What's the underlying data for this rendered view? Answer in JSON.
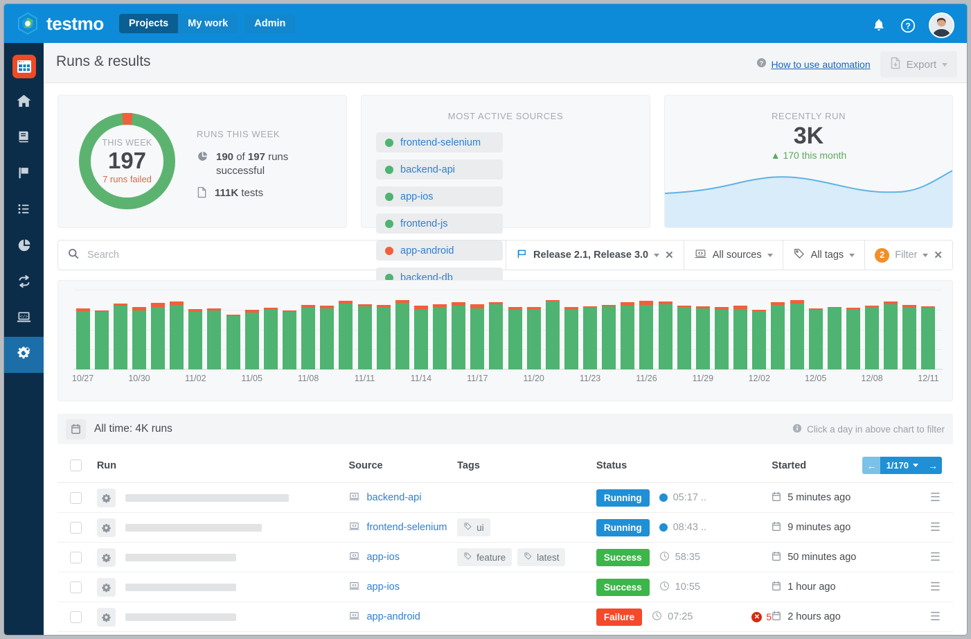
{
  "brand": {
    "name": "testmo",
    "color": "#0d8bd9"
  },
  "topnav": {
    "items": [
      {
        "label": "Projects",
        "active": true
      },
      {
        "label": "My work",
        "active": false
      },
      {
        "label": "Admin",
        "active": false,
        "separate": true
      }
    ],
    "icons": [
      {
        "name": "notifications-icon"
      },
      {
        "name": "help-icon"
      },
      {
        "name": "user-avatar"
      }
    ]
  },
  "sidebar": {
    "items": [
      {
        "name": "project-logo",
        "label": "Project"
      },
      {
        "name": "home-icon",
        "label": "Home"
      },
      {
        "name": "book-icon",
        "label": "Cases"
      },
      {
        "name": "flag-icon",
        "label": "Milestones"
      },
      {
        "name": "list-icon",
        "label": "Runs"
      },
      {
        "name": "pie-chart-icon",
        "label": "Reports"
      },
      {
        "name": "repeat-icon",
        "label": "Sessions"
      },
      {
        "name": "code-laptop-icon",
        "label": "Automation"
      },
      {
        "name": "gears-icon",
        "label": "Settings",
        "active": true
      }
    ]
  },
  "header": {
    "title": "Runs & results",
    "howto_label": "How to use automation",
    "export_label": "Export"
  },
  "cards": {
    "week": {
      "donut_label": "THIS WEEK",
      "donut_value": "197",
      "donut_sub": "7 runs failed",
      "section_title": "RUNS THIS WEEK",
      "rows": [
        {
          "icon": "pie-chart-icon",
          "bold1": "190",
          "mid": " of ",
          "bold2": "197",
          "tail": " runs successful"
        },
        {
          "icon": "document-icon",
          "bold1": "111K",
          "mid": "",
          "bold2": "",
          "tail": " tests"
        }
      ],
      "success_pct": 96.4,
      "colors": {
        "pass": "#5cb370",
        "fail": "#f0603c"
      }
    },
    "sources": {
      "title": "MOST ACTIVE SOURCES",
      "items": [
        {
          "label": "frontend-selenium",
          "status": "pass"
        },
        {
          "label": "backend-api",
          "status": "pass"
        },
        {
          "label": "app-ios",
          "status": "pass"
        },
        {
          "label": "frontend-js",
          "status": "pass"
        },
        {
          "label": "app-android",
          "status": "fail"
        },
        {
          "label": "backend-db",
          "status": "pass"
        }
      ]
    },
    "recent": {
      "title": "RECENTLY RUN",
      "value": "3K",
      "trend": "170 this month",
      "trend_dir": "up"
    }
  },
  "filterbar": {
    "search_placeholder": "Search",
    "search_value": "",
    "milestone_label": "Release 2.1, Release 3.0",
    "sources_label": "All sources",
    "tags_label": "All tags",
    "filter_label": "Filter",
    "filter_count": "2"
  },
  "chart_data": {
    "type": "bar",
    "title": "",
    "xlabel": "",
    "ylabel": "",
    "stacked": true,
    "grid": true,
    "legend": "none",
    "ylim": [
      0,
      110
    ],
    "series": [
      {
        "name": "passed",
        "color": "#4fb371"
      },
      {
        "name": "failed",
        "color": "#f0603c"
      }
    ],
    "categories": [
      "10/27",
      "10/28",
      "10/29",
      "10/30",
      "10/31",
      "11/01",
      "11/02",
      "11/03",
      "11/04",
      "11/05",
      "11/06",
      "11/07",
      "11/08",
      "11/09",
      "11/10",
      "11/11",
      "11/12",
      "11/13",
      "11/14",
      "11/15",
      "11/16",
      "11/17",
      "11/18",
      "11/19",
      "11/20",
      "11/21",
      "11/22",
      "11/23",
      "11/24",
      "11/25",
      "11/26",
      "11/27",
      "11/28",
      "11/29",
      "11/30",
      "12/01",
      "12/02",
      "12/03",
      "12/04",
      "12/05",
      "12/06",
      "12/07",
      "12/08",
      "12/09",
      "12/10",
      "12/11"
    ],
    "tick_labels": [
      "10/27",
      "10/30",
      "11/02",
      "11/05",
      "11/08",
      "11/11",
      "11/14",
      "11/17",
      "11/20",
      "11/23",
      "11/26",
      "11/29",
      "12/02",
      "12/05",
      "12/08",
      "12/11"
    ],
    "tick_every": 3,
    "passed": [
      80,
      79,
      88,
      81,
      86,
      89,
      79,
      81,
      74,
      78,
      82,
      79,
      85,
      84,
      91,
      87,
      86,
      92,
      83,
      86,
      88,
      84,
      90,
      82,
      83,
      94,
      83,
      85,
      87,
      88,
      89,
      90,
      86,
      84,
      82,
      83,
      80,
      89,
      91,
      82,
      85,
      83,
      86,
      90,
      86,
      85
    ],
    "failed": [
      4,
      2,
      3,
      5,
      6,
      5,
      4,
      3,
      2,
      4,
      3,
      2,
      4,
      4,
      4,
      3,
      3,
      4,
      5,
      4,
      5,
      6,
      3,
      4,
      3,
      2,
      3,
      2,
      2,
      5,
      6,
      4,
      2,
      3,
      4,
      5,
      2,
      4,
      5,
      2,
      1,
      2,
      2,
      4,
      3,
      2
    ]
  },
  "alltime": {
    "label": "All time: 4K runs",
    "hint": "Click a day in above chart to filter"
  },
  "table": {
    "columns": [
      "Run",
      "Source",
      "Tags",
      "Status",
      "Started"
    ],
    "pager": {
      "page": "1/170"
    },
    "rows": [
      {
        "name_width": 236,
        "source": "backend-api",
        "tags": [],
        "status": {
          "label": "Running",
          "kind": "running"
        },
        "duration": "05:17 ..",
        "duration_icon": "dot",
        "fails": "",
        "started": "5 minutes ago"
      },
      {
        "name_width": 197,
        "source": "frontend-selenium",
        "tags": [
          "ui"
        ],
        "status": {
          "label": "Running",
          "kind": "running"
        },
        "duration": "08:43 ..",
        "duration_icon": "dot",
        "fails": "",
        "started": "9 minutes ago"
      },
      {
        "name_width": 160,
        "source": "app-ios",
        "tags": [
          "feature",
          "latest"
        ],
        "status": {
          "label": "Success",
          "kind": "success"
        },
        "duration": "58:35",
        "duration_icon": "clock",
        "fails": "",
        "started": "50 minutes ago"
      },
      {
        "name_width": 160,
        "source": "app-ios",
        "tags": [],
        "status": {
          "label": "Success",
          "kind": "success"
        },
        "duration": "10:55",
        "duration_icon": "clock",
        "fails": "",
        "started": "1 hour ago"
      },
      {
        "name_width": 160,
        "source": "app-android",
        "tags": [],
        "status": {
          "label": "Failure",
          "kind": "failure"
        },
        "duration": "07:25",
        "duration_icon": "clock",
        "fails": "5",
        "started": "2 hours ago"
      }
    ]
  }
}
